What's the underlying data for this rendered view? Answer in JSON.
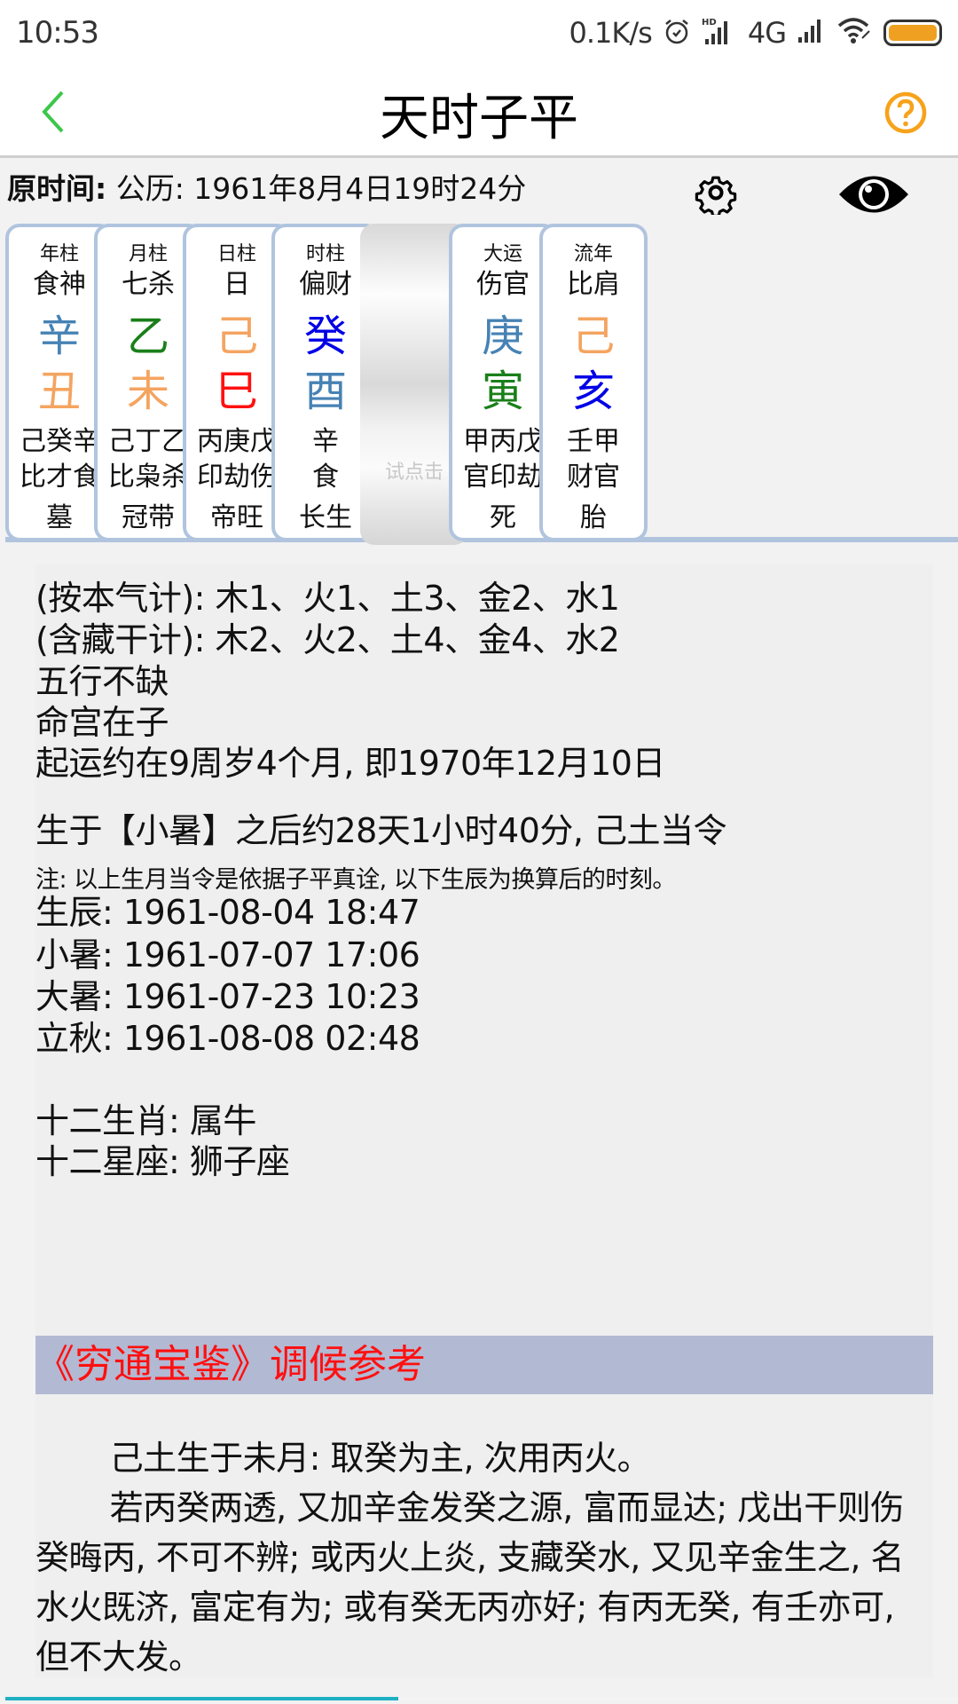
{
  "status_bar": {
    "time": "10:53",
    "net_speed": "0.1K/s",
    "icons": [
      "alarm-icon",
      "hd-signal-icon",
      "4g-icon",
      "signal-icon",
      "wifi-icon",
      "battery-icon"
    ],
    "network_label": "4G",
    "battery_color": "#f0a021"
  },
  "header": {
    "title": "天时子平",
    "back_icon": "chevron-left-icon",
    "help_icon": "help-circle-icon",
    "back_color": "#3cc74b",
    "help_color": "#f7a21b"
  },
  "orig_time": {
    "label": "原时间:",
    "value": "公历: 1961年8月4日19时24分",
    "settings_icon": "gear-icon",
    "view_icon": "eye-icon"
  },
  "pillars": [
    {
      "header": "年柱",
      "ten_god": "食神",
      "stem": "辛",
      "stem_element": "metal",
      "branch": "丑",
      "branch_element": "earth",
      "hidden_stems": "己癸辛",
      "hidden_gods": "比才食",
      "phase": "墓"
    },
    {
      "header": "月柱",
      "ten_god": "七杀",
      "stem": "乙",
      "stem_element": "wood",
      "branch": "未",
      "branch_element": "earth",
      "hidden_stems": "己丁乙",
      "hidden_gods": "比枭杀",
      "phase": "冠带"
    },
    {
      "header": "日柱",
      "ten_god": "日",
      "stem": "己",
      "stem_element": "earth",
      "branch": "巳",
      "branch_element": "fire",
      "hidden_stems": "丙庚戊",
      "hidden_gods": "印劫伤",
      "phase": "帝旺"
    },
    {
      "header": "时柱",
      "ten_god": "偏财",
      "stem": "癸",
      "stem_element": "water",
      "branch": "酉",
      "branch_element": "metal",
      "hidden_stems": "辛",
      "hidden_gods": "食",
      "phase": "长生"
    }
  ],
  "tap_button": {
    "label": "试点击"
  },
  "run_pillars": [
    {
      "header": "大运",
      "ten_god": "伤官",
      "stem": "庚",
      "stem_element": "metal",
      "branch": "寅",
      "branch_element": "wood",
      "hidden_stems": "甲丙戊",
      "hidden_gods": "官印劫",
      "phase": "死"
    },
    {
      "header": "流年",
      "ten_god": "比肩",
      "stem": "己",
      "stem_element": "earth",
      "branch": "亥",
      "branch_element": "water",
      "hidden_stems": "壬甲",
      "hidden_gods": "财官",
      "phase": "胎"
    }
  ],
  "element_colors": {
    "metal": "#4682b4",
    "wood": "#1a7f1a",
    "earth": "#f4a460",
    "fire": "#ff1010",
    "water": "#0000e6"
  },
  "analysis": {
    "count_main": "(按本气计): 木1、火1、土3、金2、水1",
    "count_hidden": "(含藏干计): 木2、火2、土4、金4、水2",
    "five_elements": "五行不缺",
    "life_palace": "命宫在子",
    "luck_start": "起运约在9周岁4个月, 即1970年12月10日",
    "solar_term": "生于【小暑】之后约28天1小时40分, 己土当令",
    "note": "注: 以上生月当令是依据子平真诠, 以下生辰为换算后的时刻。",
    "times": [
      "生辰: 1961-08-04 18:47",
      "小暑: 1961-07-07 17:06",
      "大暑: 1961-07-23 10:23",
      "立秋: 1961-08-08 02:48"
    ],
    "zodiac": "十二生肖: 属牛",
    "constellation": "十二星座: 狮子座"
  },
  "reference": {
    "title": "《穷通宝鉴》调候参考",
    "title_color": "#ff1010",
    "title_bg": "#b2b9d3",
    "paragraphs": [
      "己土生于未月: 取癸为主, 次用丙火。",
      "若丙癸两透, 又加辛金发癸之源, 富而显达; 戊出干则伤癸晦丙, 不可不辨; 或丙火上炎, 支藏癸水, 又见辛金生之, 名水火既济, 富定有为; 或有癸无丙亦好; 有丙无癸, 有壬亦可, 但不大发。"
    ]
  },
  "progress": {
    "fraction": 0.41,
    "color": "#1fb0c4"
  }
}
